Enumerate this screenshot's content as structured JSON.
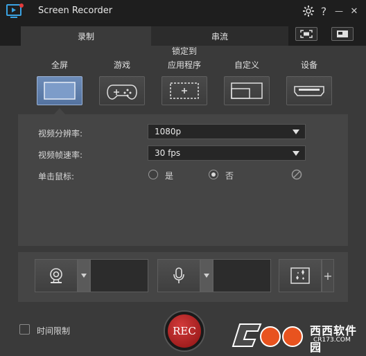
{
  "app": {
    "title": "Screen Recorder",
    "settings_icon": "gear-icon",
    "help_label": "?",
    "minimize_label": "—",
    "close_label": "✕"
  },
  "tabs": [
    {
      "label": "录制",
      "active": true
    },
    {
      "label": "串流",
      "active": false
    }
  ],
  "modes": [
    {
      "label": "全屏",
      "icon": "fullscreen-icon",
      "selected": true
    },
    {
      "label": "游戏",
      "icon": "gamepad-icon",
      "selected": false
    },
    {
      "label": "锁定到应用程序",
      "line1": "锁定到",
      "line2": "应用程序",
      "icon": "app-lock-icon",
      "selected": false
    },
    {
      "label": "自定义",
      "icon": "custom-region-icon",
      "selected": false
    },
    {
      "label": "设备",
      "icon": "hdmi-device-icon",
      "selected": false
    }
  ],
  "settings": {
    "resolution_label": "视频分辨率:",
    "resolution_value": "1080p",
    "framerate_label": "视频帧速率:",
    "framerate_value": "30 fps",
    "click_label": "单击鼠标:",
    "click_options": [
      {
        "label": "是",
        "checked": false
      },
      {
        "label": "否",
        "checked": true
      }
    ]
  },
  "devices": {
    "webcam_icon": "webcam-icon",
    "mic_icon": "microphone-icon",
    "effects_icon": "sparkle-effect-icon",
    "plus_label": "+"
  },
  "footer": {
    "time_limit_label": "时间限制",
    "rec_label": "REC",
    "watermark_text": "西西软件园",
    "watermark_url": "CR173.COM"
  },
  "colors": {
    "accent_selected": "#6d8cb8",
    "rec_red": "#c02525",
    "background": "#2b2b2b",
    "panel": "#3a3a3a"
  }
}
